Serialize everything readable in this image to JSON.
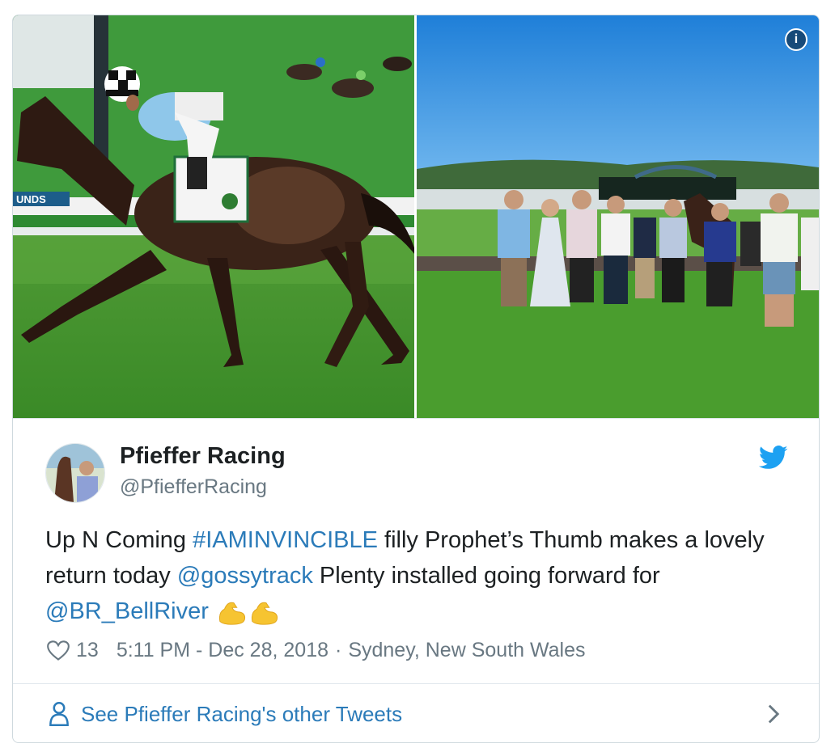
{
  "media": {
    "left_photo": "horse-racing-photo",
    "right_photo": "winners-circle-photo",
    "info_label": "i"
  },
  "author": {
    "name": "Pfieffer Racing",
    "handle": "@PfiefferRacing"
  },
  "tweet": {
    "part1": "Up N Coming ",
    "hashtag": "#IAMINVINCIBLE",
    "part2": " filly Prophet’s Thumb makes a lovely return today ",
    "mention1": "@gossytrack",
    "part3": " Plenty installed going forward for ",
    "mention2": "@BR_BellRiver",
    "emoji": "flexed-biceps"
  },
  "meta": {
    "likes": "13",
    "timestamp": "5:11 PM - Dec 28, 2018",
    "separator": "·",
    "location": "Sydney, New South Wales"
  },
  "footer": {
    "label": "See Pfieffer Racing's other Tweets"
  },
  "colors": {
    "link": "#2b7bb9",
    "meta": "#697882",
    "twitter_blue": "#1da1f2"
  }
}
